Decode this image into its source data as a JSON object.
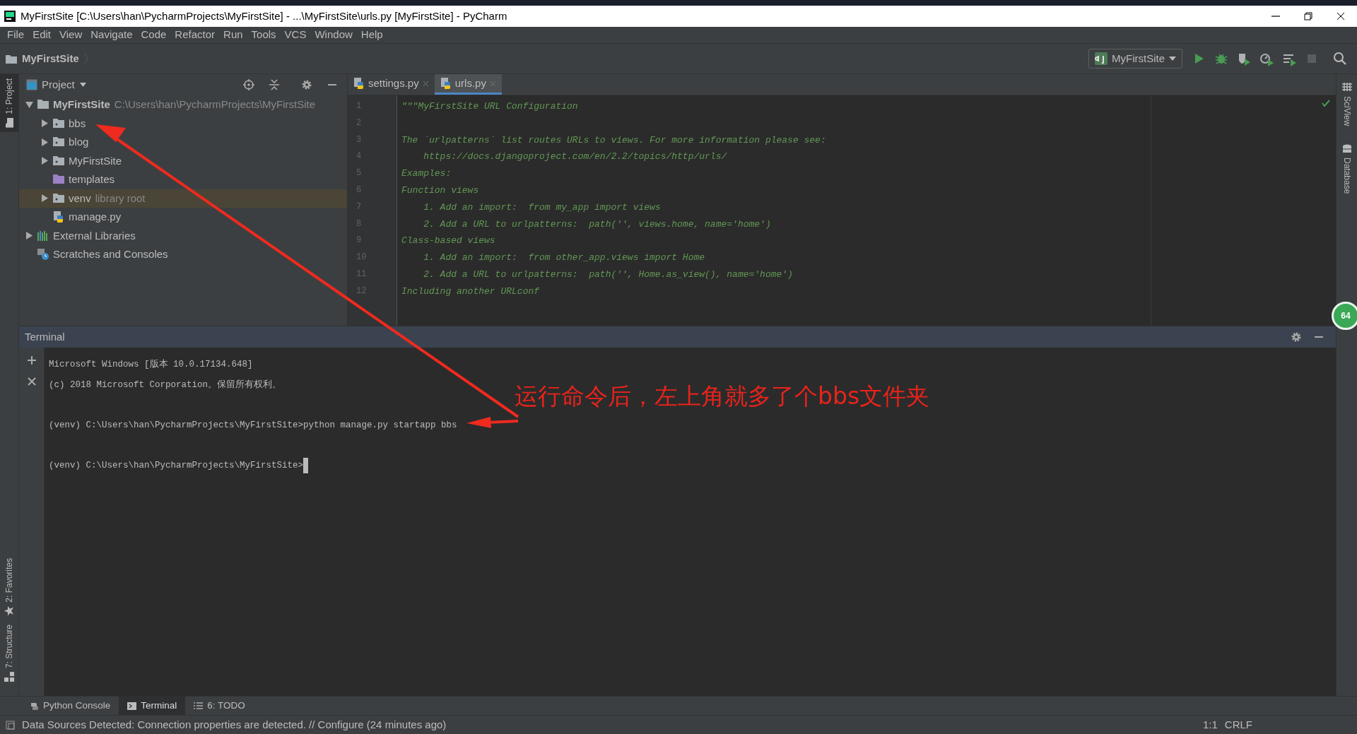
{
  "window": {
    "title": "MyFirstSite [C:\\Users\\han\\PycharmProjects\\MyFirstSite] - ...\\MyFirstSite\\urls.py [MyFirstSite] - PyCharm"
  },
  "menu": [
    "File",
    "Edit",
    "View",
    "Navigate",
    "Code",
    "Refactor",
    "Run",
    "Tools",
    "VCS",
    "Window",
    "Help"
  ],
  "breadcrumb": "MyFirstSite",
  "run_config": "MyFirstSite",
  "left_stripe": [
    {
      "label": "1: Project",
      "selected": true,
      "kind": "folder"
    },
    {
      "label": "2: Favorites",
      "selected": false,
      "kind": "star"
    },
    {
      "label": "7: Structure",
      "selected": false,
      "kind": "structure"
    }
  ],
  "right_stripe": [
    {
      "label": "SciView",
      "kind": "grid"
    },
    {
      "label": "Database",
      "kind": "database"
    }
  ],
  "project_panel": {
    "title": "Project",
    "tree": [
      {
        "label": "MyFirstSite",
        "hint": "C:\\Users\\han\\PycharmProjects\\MyFirstSite",
        "kind": "root",
        "expanded": true,
        "selected": false,
        "children": [
          {
            "label": "bbs",
            "kind": "folder",
            "expanded": false,
            "selected": false
          },
          {
            "label": "blog",
            "kind": "folder",
            "expanded": false,
            "selected": false
          },
          {
            "label": "MyFirstSite",
            "kind": "folder",
            "expanded": false,
            "selected": false
          },
          {
            "label": "templates",
            "kind": "templates",
            "selected": false
          },
          {
            "label": "venv",
            "hint": "library root",
            "kind": "folder",
            "expanded": false,
            "selected": true
          },
          {
            "label": "manage.py",
            "kind": "python",
            "selected": false
          }
        ]
      },
      {
        "label": "External Libraries",
        "kind": "library",
        "expanded": false,
        "selected": false
      },
      {
        "label": "Scratches and Consoles",
        "kind": "scratches",
        "selected": false
      }
    ]
  },
  "editor": {
    "tabs": [
      {
        "label": "settings.py",
        "selected": false
      },
      {
        "label": "urls.py",
        "selected": true
      }
    ],
    "lines": [
      {
        "number": "1",
        "text": "\"\"\"MyFirstSite URL Configuration"
      },
      {
        "number": "2"
      },
      {
        "number": "3",
        "text": "The `urlpatterns` list routes URLs to views. For more information please see:"
      },
      {
        "number": "4",
        "text": "    https://docs.djangoproject.com/en/2.2/topics/http/urls/"
      },
      {
        "number": "5",
        "text": "Examples:"
      },
      {
        "number": "6",
        "text": "Function views"
      },
      {
        "number": "7",
        "text": "    1. Add an import:  from my_app import views"
      },
      {
        "number": "8",
        "text": "    2. Add a URL to urlpatterns:  path('', views.home, name='home')"
      },
      {
        "number": "9",
        "text": "Class-based views"
      },
      {
        "number": "10",
        "text": "    1. Add an import:  from other_app.views import Home"
      },
      {
        "number": "11",
        "text": "    2. Add a URL to urlpatterns:  path('', Home.as_view(), name='home')"
      },
      {
        "number": "12",
        "text": "Including another URLconf"
      }
    ]
  },
  "terminal": {
    "title": "Terminal",
    "blocks": [
      {
        "lines": [
          {
            "text": "Microsoft Windows [版本 10.0.17134.648]",
            "cursor": false
          },
          {
            "text": "(c) 2018 Microsoft Corporation。保留所有权利。",
            "cursor": false
          }
        ]
      },
      {
        "lines": [
          {
            "text": "(venv) C:\\Users\\han\\PycharmProjects\\MyFirstSite>python manage.py startapp bbs",
            "cursor": false
          }
        ]
      },
      {
        "lines": [
          {
            "text": "(venv) C:\\Users\\han\\PycharmProjects\\MyFirstSite>",
            "cursor": true
          }
        ]
      }
    ]
  },
  "annotation": {
    "text": "运行命令后，左上角就多了个bbs文件夹"
  },
  "badge": "64",
  "bottom_tabs": [
    {
      "label": "Python Console",
      "selected": false,
      "kind": "python"
    },
    {
      "label": "Terminal",
      "selected": true,
      "kind": "terminal"
    },
    {
      "label": "6: TODO",
      "selected": false,
      "kind": "todo"
    }
  ],
  "status_bar": {
    "message": "Data Sources Detected: Connection properties are detected. // Configure (24 minutes ago)",
    "position": "1:1",
    "line_separator": "CRLF"
  }
}
